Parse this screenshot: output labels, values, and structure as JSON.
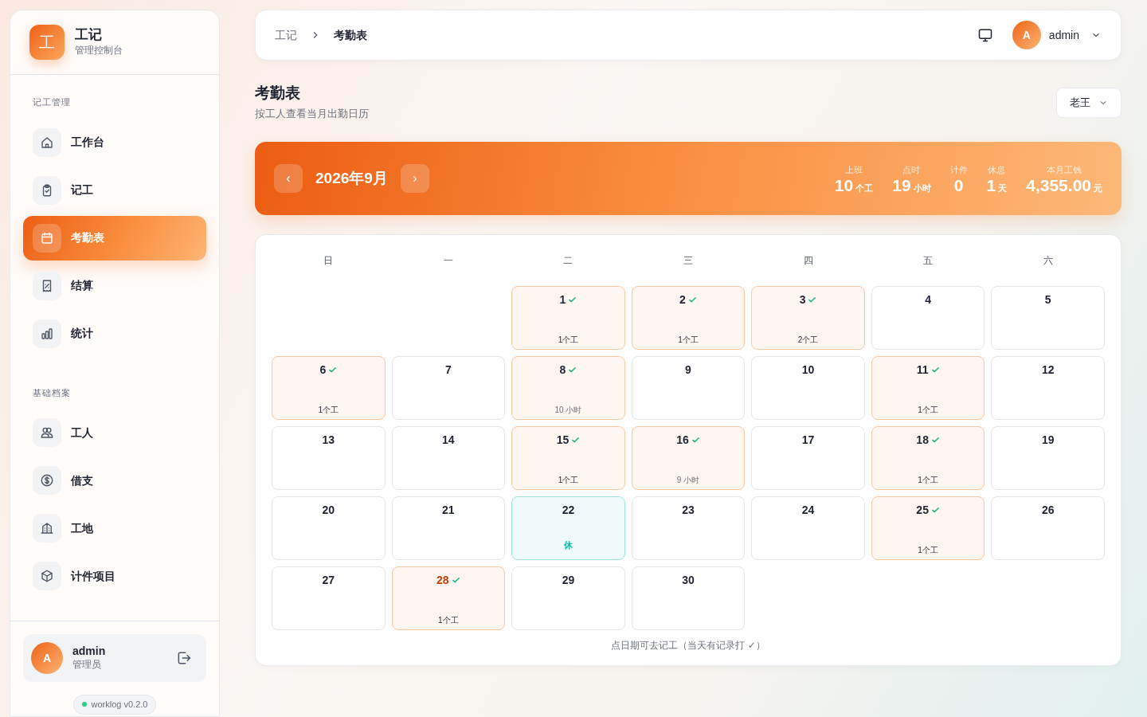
{
  "brand": {
    "logo": "工",
    "name": "工记",
    "subtitle": "管理控制台"
  },
  "nav_groups": [
    {
      "label": "记工管理",
      "items": [
        {
          "label": "工作台",
          "kind": "home",
          "selected": false
        },
        {
          "label": "记工",
          "kind": "clipboard",
          "selected": false
        },
        {
          "label": "考勤表",
          "kind": "calendar",
          "selected": true
        },
        {
          "label": "结算",
          "kind": "receipt",
          "selected": false
        },
        {
          "label": "统计",
          "kind": "chart",
          "selected": false
        }
      ]
    },
    {
      "label": "基础档案",
      "items": [
        {
          "label": "工人",
          "kind": "users",
          "selected": false
        },
        {
          "label": "借支",
          "kind": "coin",
          "selected": false
        },
        {
          "label": "工地",
          "kind": "building",
          "selected": false
        },
        {
          "label": "计件项目",
          "kind": "box",
          "selected": false
        }
      ]
    }
  ],
  "user": {
    "avatar": "A",
    "name": "admin",
    "role": "管理员"
  },
  "version": "worklog v0.2.0",
  "breadcrumb": [
    {
      "label": "工记",
      "selected": false
    },
    {
      "label": "考勤表",
      "selected": true
    }
  ],
  "top_user": {
    "avatar": "A",
    "name": "admin"
  },
  "page": {
    "title": "考勤表",
    "subtitle": "按工人查看当月出勤日历"
  },
  "worker_select": {
    "value": "老王"
  },
  "banner": {
    "prev": "‹",
    "month": "2026年9月",
    "next": "›",
    "stats": [
      {
        "label": "上班",
        "value": "10",
        "unit": "个工"
      },
      {
        "label": "点时",
        "value": "19",
        "unit": "小时"
      },
      {
        "label": "计件",
        "value": "0"
      },
      {
        "label": "休息",
        "value": "1",
        "unit": "天"
      },
      {
        "label": "本月工钱",
        "value": "4,355.00",
        "unit": "元"
      }
    ]
  },
  "weekdays": [
    "日",
    "一",
    "二",
    "三",
    "四",
    "五",
    "六"
  ],
  "weeks": [
    [
      {
        "kind": "blank"
      },
      {
        "kind": "blank"
      },
      {
        "kind": "work",
        "day": "1",
        "checked": true,
        "note": "1个工"
      },
      {
        "kind": "work",
        "day": "2",
        "checked": true,
        "note": "1个工"
      },
      {
        "kind": "work",
        "day": "3",
        "checked": true,
        "note": "2个工"
      },
      {
        "kind": "plain",
        "day": "4"
      },
      {
        "kind": "plain",
        "day": "5"
      }
    ],
    [
      {
        "kind": "work",
        "day": "6",
        "checked": true,
        "note": "1个工"
      },
      {
        "kind": "plain",
        "day": "7"
      },
      {
        "kind": "hours",
        "day": "8",
        "checked": true,
        "note": "10 小时"
      },
      {
        "kind": "plain",
        "day": "9"
      },
      {
        "kind": "plain",
        "day": "10"
      },
      {
        "kind": "work",
        "day": "11",
        "checked": true,
        "note": "1个工"
      },
      {
        "kind": "plain",
        "day": "12"
      }
    ],
    [
      {
        "kind": "plain",
        "day": "13"
      },
      {
        "kind": "plain",
        "day": "14"
      },
      {
        "kind": "work",
        "day": "15",
        "checked": true,
        "note": "1个工"
      },
      {
        "kind": "hours",
        "day": "16",
        "checked": true,
        "note": "9 小时"
      },
      {
        "kind": "plain",
        "day": "17"
      },
      {
        "kind": "work",
        "day": "18",
        "checked": true,
        "note": "1个工"
      },
      {
        "kind": "plain",
        "day": "19"
      }
    ],
    [
      {
        "kind": "plain",
        "day": "20"
      },
      {
        "kind": "plain",
        "day": "21"
      },
      {
        "kind": "rest",
        "day": "22",
        "note": "休"
      },
      {
        "kind": "plain",
        "day": "23"
      },
      {
        "kind": "plain",
        "day": "24"
      },
      {
        "kind": "work",
        "day": "25",
        "checked": true,
        "note": "1个工"
      },
      {
        "kind": "plain",
        "day": "26"
      }
    ],
    [
      {
        "kind": "plain",
        "day": "27"
      },
      {
        "kind": "work",
        "day": "28",
        "checked": true,
        "today": true,
        "note": "1个工"
      },
      {
        "kind": "plain",
        "day": "29"
      },
      {
        "kind": "plain",
        "day": "30"
      }
    ]
  ],
  "footnote": "点日期可去记工（当天有记录打 ✓）"
}
